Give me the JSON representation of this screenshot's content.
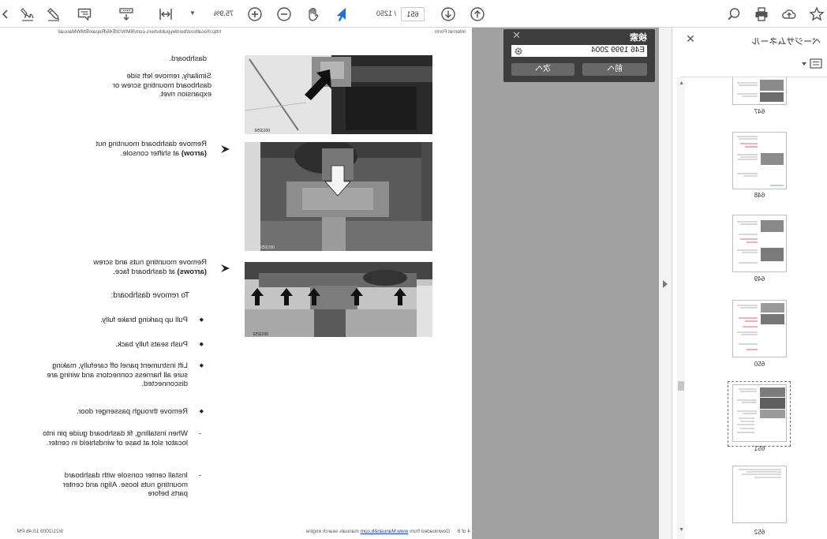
{
  "toolbar": {
    "icons": [
      "star-icon",
      "cloud-upload-icon",
      "print-icon",
      "search-icon",
      "page-up-icon",
      "page-down-icon",
      "select-arrow-icon",
      "hand-icon",
      "zoom-out-icon",
      "zoom-in-icon",
      "fit-page-icon",
      "scroll-mode-icon",
      "comment-icon",
      "pen-icon",
      "sign-icon",
      "more-icon"
    ],
    "page_current": "651",
    "page_total": "/ 1250",
    "zoom": "75.9%"
  },
  "thumbnails": {
    "title": "ページサムネール",
    "pages": [
      "647",
      "648",
      "649",
      "650",
      "651",
      "652"
    ],
    "selected": "651"
  },
  "search": {
    "title": "検索",
    "query": "E46 1999 2004",
    "prev": "前へ",
    "next": "次へ"
  },
  "colors": {
    "accent": "#1473e6",
    "canvas": "#a1a1a1",
    "popup": "#3d3d3d"
  },
  "document": {
    "header_title": "Internet Form",
    "header_url": "http://localhost/bentleypublishers.com/BMW/3/E46/Repair/BMWManual/",
    "top_text": "dashboard.",
    "step1": "Similarly, remove left side dashboard mounting screw or expansion rivet.",
    "step2": {
      "before": "Remove dashboard mounting nut ",
      "bold": "(arrow)",
      "after": " at shifter console."
    },
    "step3": {
      "before": "Remove mounting nuts and screw ",
      "bold": "(arrows)",
      "after": " at dashboard face."
    },
    "intro": "To remove dashboard:",
    "bullets": [
      "Pull up parking brake fully.",
      "Push seats fully back.",
      "Lift instrument panel off carefully, making sure all harness connectors and wiring are disconnected.",
      "Remove through passenger door."
    ],
    "notes": [
      "When installing, fit dashboard guide pin into locator slot at base of windshield in center.",
      "Install center console with dashboard mounting nuts loose. Align and center parts before"
    ],
    "figure_captions": [
      "0013256",
      "0013251",
      "0013253"
    ],
    "footer": {
      "datetime": "9/21/2009 10:46 PM",
      "page": "4 of 8",
      "download_prefix": "Downloaded from ",
      "download_link": "www.Manualslib.com",
      "download_suffix": " manuals search engine"
    }
  }
}
